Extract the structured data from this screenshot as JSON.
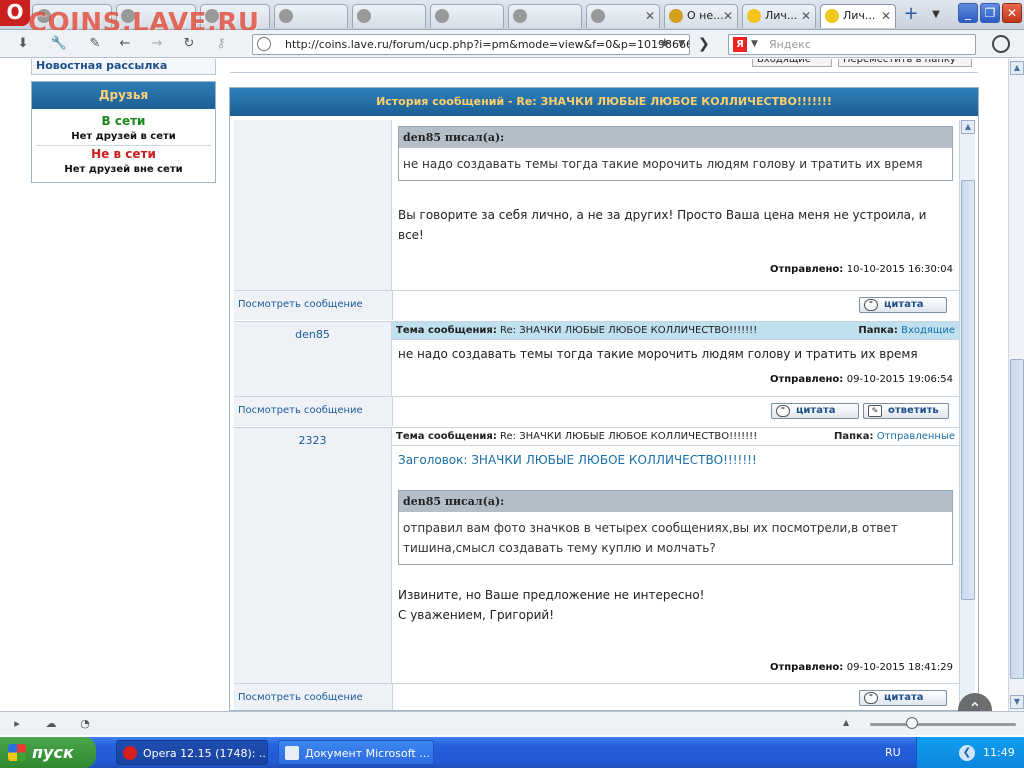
{
  "browser": {
    "watermark": "COINS.LAVE.RU",
    "tabs": [
      {
        "label": "",
        "active": false
      },
      {
        "label": "",
        "active": false
      },
      {
        "label": "",
        "active": false
      },
      {
        "label": "",
        "active": false
      },
      {
        "label": "",
        "active": false
      },
      {
        "label": "",
        "active": false
      },
      {
        "label": "",
        "active": false
      },
      {
        "label": "О не...",
        "active": false
      },
      {
        "label": "Лич...",
        "active": false
      },
      {
        "label": "Лич...",
        "active": true
      }
    ],
    "address": "http://coins.lave.ru/forum/ucp.php?i=pm&mode=view&f=0&p=10198666",
    "search_placeholder": "Яндекс",
    "search_engine_letter": "Я"
  },
  "sidebar": {
    "newsletter_link": "Новостная рассылка",
    "friends_title": "Друзья",
    "online_label": "В сети",
    "online_note": "Нет друзей в сети",
    "offline_label": "Не в сети",
    "offline_note": "Нет друзей вне сети"
  },
  "top_strip": {
    "left_text": "Д... ...",
    "select_folder": "Входящие",
    "select_move": "Переместить в папку"
  },
  "history": {
    "title": "История сообщений - Re: ЗНАЧКИ ЛЮБЫЕ ЛЮБОЕ КОЛЛИЧЕСТВО!!!!!!!",
    "messages": [
      {
        "author": "",
        "quote_author": "den85 писал(а):",
        "quote_text": "не надо создавать темы тогда такие морочить людям голову и тратить их время",
        "text": "Вы говорите за себя лично, а не за других! Просто Ваша цена меня не устроила, и все!",
        "sent_label": "Отправлено:",
        "sent_date": "10-10-2015 16:30:04",
        "view_link": "Посмотреть сообщение",
        "quote_button": "цитата"
      },
      {
        "author": "den85",
        "subject_label": "Тема сообщения:",
        "subject": "Re: ЗНАЧКИ ЛЮБЫЕ ЛЮБОЕ КОЛЛИЧЕСТВО!!!!!!!",
        "folder_label": "Папка:",
        "folder": "Входящие",
        "text": "не надо создавать темы тогда такие морочить людям голову и тратить их время",
        "sent_label": "Отправлено:",
        "sent_date": "09-10-2015 19:06:54",
        "view_link": "Посмотреть сообщение",
        "quote_button": "цитата",
        "reply_button": "ответить"
      },
      {
        "author": "2323",
        "subject_label": "Тема сообщения:",
        "subject": "Re: ЗНАЧКИ ЛЮБЫЕ ЛЮБОЕ КОЛЛИЧЕСТВО!!!!!!!",
        "folder_label": "Папка:",
        "folder": "Отправленные",
        "heading": "Заголовок: ЗНАЧКИ ЛЮБЫЕ ЛЮБОЕ КОЛЛИЧЕСТВО!!!!!!!",
        "quote_author": "den85 писал(а):",
        "quote_text": "отправил вам фото значков в четырех сообщениях,вы их посмотрели,в ответ тишина,смысл создавать тему куплю и молчать?",
        "text_line1": "Извините, но Ваше предложение не интересно!",
        "text_line2": "С уважением, Григорий!",
        "sent_label": "Отправлено:",
        "sent_date": "09-10-2015 18:41:29",
        "view_link": "Посмотреть сообщение",
        "quote_button": "цитата"
      }
    ]
  },
  "taskbar": {
    "start_label": "пуск",
    "tasks": [
      {
        "label": "Opera 12.15 (1748): ..."
      },
      {
        "label": "Документ Microsoft ..."
      }
    ],
    "language": "RU",
    "clock": "11:49"
  },
  "colors": {
    "header_blue": "#1b5f95",
    "header_text": "#ffcf6b",
    "link_blue": "#1a5a9a",
    "online_green": "#1a8a1a",
    "offline_red": "#cc1e1e"
  }
}
